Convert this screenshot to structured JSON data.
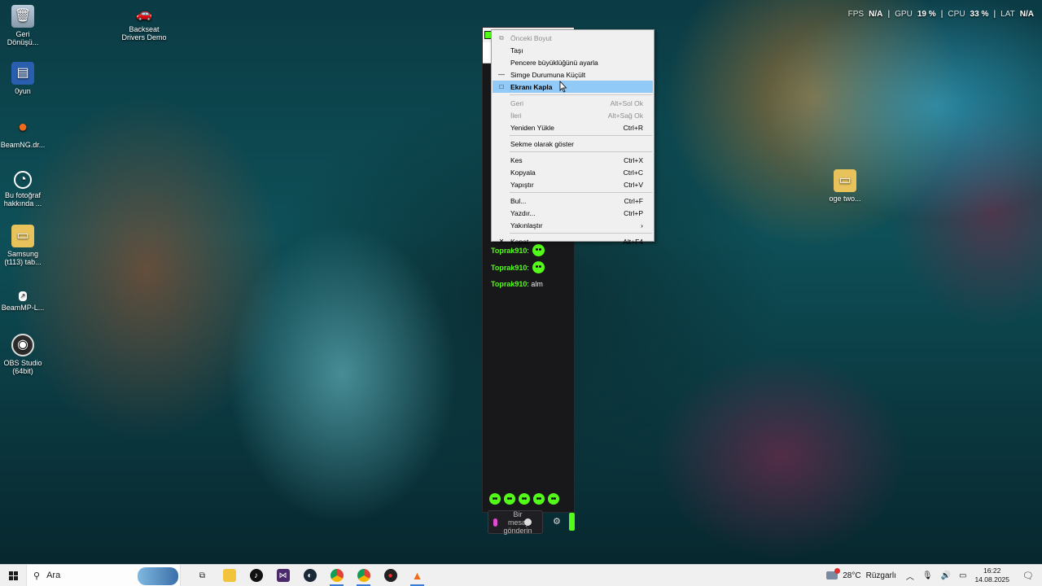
{
  "desktop": {
    "icons": [
      {
        "label": "Geri Dönüşü...",
        "icon": "recycle-bin-icon"
      },
      {
        "label": "Backseat Drivers Demo",
        "icon": "game-shortcut-icon"
      },
      {
        "label": "0yun",
        "icon": "folder-icon"
      },
      {
        "label": "BeamNG.dr...",
        "icon": "beamng-icon"
      },
      {
        "label": "Bu fotoğraf hakkında ...",
        "icon": "camera-icon"
      },
      {
        "label": "Samsung (t113) tab...",
        "icon": "folder-icon"
      },
      {
        "label": "BeamMP-L...",
        "icon": "shortcut-icon"
      },
      {
        "label": "OBS Studio (64bit)",
        "icon": "obs-icon"
      },
      {
        "label": "oge two...",
        "icon": "folder-icon"
      }
    ]
  },
  "overlay": {
    "fps_label": "FPS",
    "fps_value": "N/A",
    "gpu_label": "GPU",
    "gpu_value": "19 %",
    "cpu_label": "CPU",
    "cpu_value": "33 %",
    "lat_label": "LAT",
    "lat_value": "N/A"
  },
  "chat": {
    "messages": [
      {
        "user": "Toprak910",
        "text": ""
      },
      {
        "user": "Toprak910",
        "text": ""
      },
      {
        "user": "Toprak910",
        "text": "alm"
      }
    ],
    "input_placeholder": "Bir mesaj gönderin",
    "accent": "#53fc18"
  },
  "context_menu": {
    "items": [
      {
        "label": "Önceki Boyut",
        "shortcut": "",
        "icon": "restore-icon",
        "disabled": true
      },
      {
        "label": "Taşı",
        "shortcut": "",
        "icon": "",
        "disabled": false
      },
      {
        "label": "Pencere büyüklüğünü ayarla",
        "shortcut": "",
        "icon": "",
        "disabled": false
      },
      {
        "label": "Simge Durumuna Küçült",
        "shortcut": "",
        "icon": "minimize-icon",
        "disabled": false
      },
      {
        "label": "Ekranı Kapla",
        "shortcut": "",
        "icon": "maximize-icon",
        "disabled": false,
        "hover": true
      },
      {
        "label": "Geri",
        "shortcut": "Alt+Sol Ok",
        "disabled": true
      },
      {
        "label": "İleri",
        "shortcut": "Alt+Sağ Ok",
        "disabled": true
      },
      {
        "label": "Yeniden Yükle",
        "shortcut": "Ctrl+R",
        "disabled": false
      },
      {
        "label": "Sekme olarak göster",
        "shortcut": "",
        "disabled": false
      },
      {
        "label": "Kes",
        "shortcut": "Ctrl+X",
        "disabled": false
      },
      {
        "label": "Kopyala",
        "shortcut": "Ctrl+C",
        "disabled": false
      },
      {
        "label": "Yapıştır",
        "shortcut": "Ctrl+V",
        "disabled": false
      },
      {
        "label": "Bul...",
        "shortcut": "Ctrl+F",
        "disabled": false
      },
      {
        "label": "Yazdır...",
        "shortcut": "Ctrl+P",
        "disabled": false
      },
      {
        "label": "Yakınlaştır",
        "shortcut": "›",
        "disabled": false
      },
      {
        "label": "Kapat",
        "shortcut": "Alt+F4",
        "icon": "close-icon",
        "disabled": false
      }
    ]
  },
  "taskbar": {
    "search_placeholder": "Ara",
    "apps": [
      "task-view-icon",
      "file-explorer-icon",
      "tiktok-icon",
      "visual-studio-icon",
      "steam-icon",
      "chrome-icon",
      "chrome-icon",
      "beamng-icon",
      "beammp-icon"
    ],
    "weather_temp": "28°C",
    "weather_desc": "Rüzgarlı",
    "time": "16:22",
    "date": "14.08.2025"
  }
}
